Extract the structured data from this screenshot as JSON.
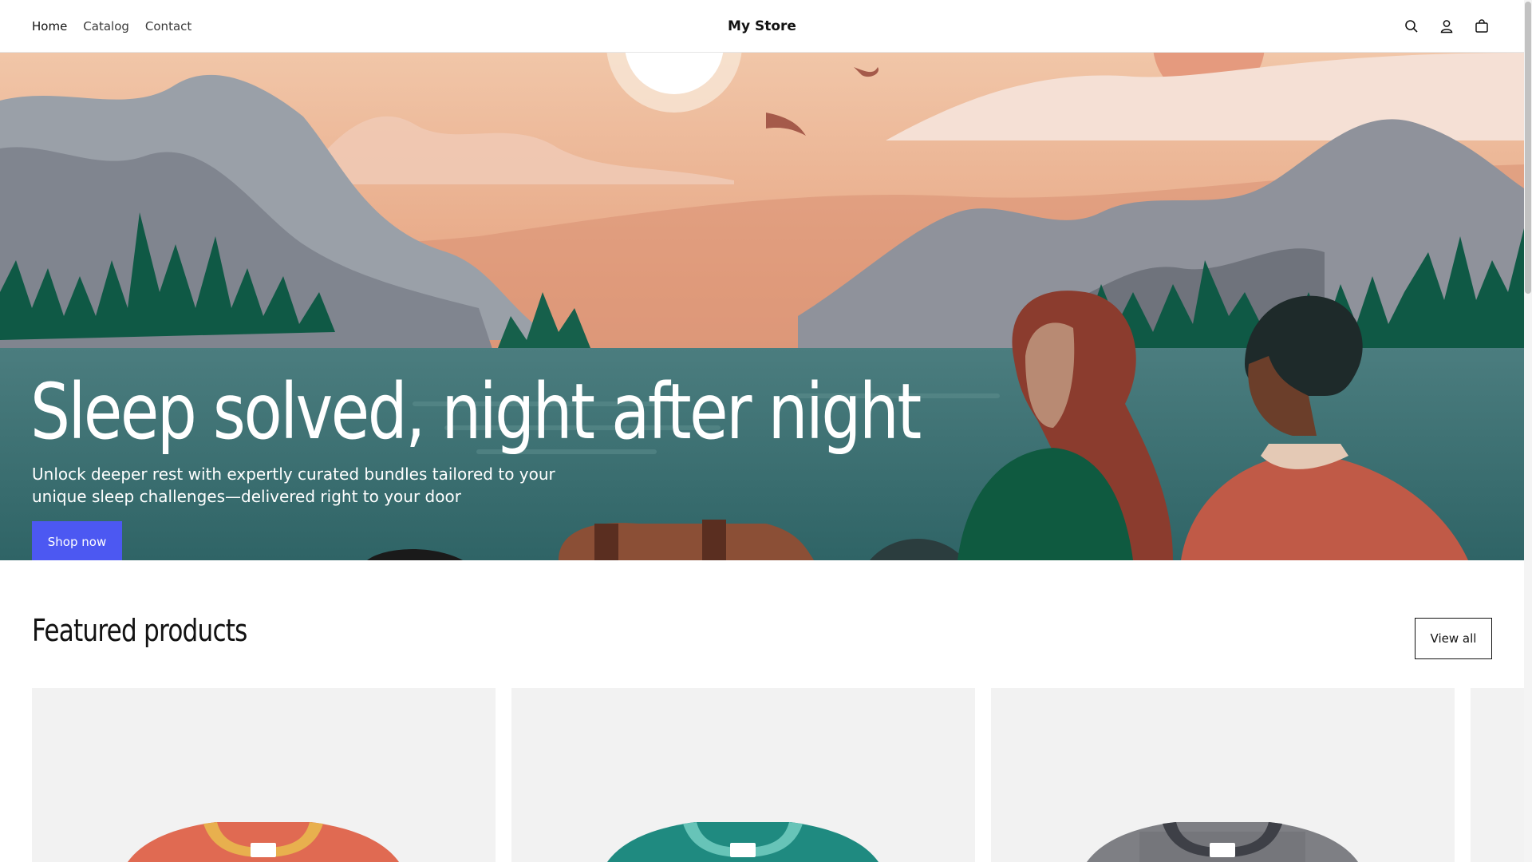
{
  "header": {
    "nav": [
      {
        "label": "Home"
      },
      {
        "label": "Catalog"
      },
      {
        "label": "Contact"
      }
    ],
    "brand": "My Store",
    "icons": [
      "search-icon",
      "account-icon",
      "cart-icon"
    ]
  },
  "hero": {
    "title": "Sleep solved, night after night",
    "subtitle": "Unlock deeper rest with expertly curated bundles tailored to your unique sleep challenges—delivered right to your door",
    "cta": "Shop now"
  },
  "featured": {
    "title": "Featured products",
    "view_all": "View all",
    "products": [
      {
        "shirt_color": "#e06a52",
        "collar_color": "#e8b04e"
      },
      {
        "shirt_color": "#1f8a80",
        "collar_color": "#67c4b8"
      },
      {
        "shirt_color": "#7e7f84",
        "collar_color": "#3e4047"
      }
    ]
  },
  "colors": {
    "accent": "#4c58f2",
    "text": "#121212"
  }
}
